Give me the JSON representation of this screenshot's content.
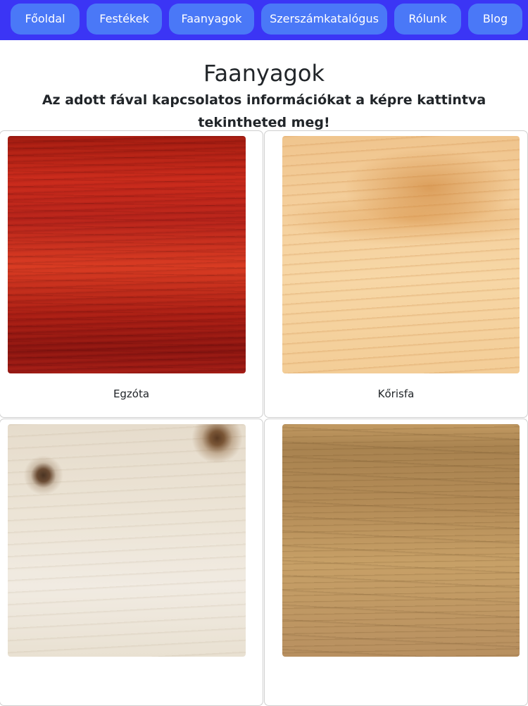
{
  "nav": {
    "items": [
      {
        "label": "Főoldal"
      },
      {
        "label": "Festékek"
      },
      {
        "label": "Faanyagok"
      },
      {
        "label": "Szerszámkatalógus"
      },
      {
        "label": "Rólunk"
      },
      {
        "label": "Blog"
      }
    ]
  },
  "header": {
    "title": "Faanyagok",
    "subtitle": "Az adott fával kapcsolatos információkat a képre kattintva tekintheted meg!"
  },
  "cards": [
    {
      "caption": "Egzóta"
    },
    {
      "caption": "Kőrisfa"
    },
    {
      "caption": ""
    },
    {
      "caption": ""
    }
  ],
  "colors": {
    "navbar_bg": "#3b35f5",
    "nav_button_bg": "#4a78f7",
    "nav_button_text": "#ffffff"
  }
}
